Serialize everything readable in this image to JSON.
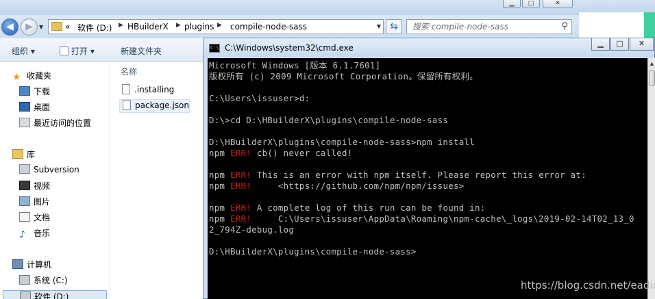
{
  "explorer": {
    "address": {
      "overflow": "«",
      "crumbs": [
        "软件 (D:)",
        "HBuilderX",
        "plugins",
        "compile-node-sass"
      ]
    },
    "search": {
      "placeholder": "搜索 compile-node-sass"
    },
    "toolbar": {
      "organize": "组织 ▾",
      "open": "打开 ▾",
      "new_folder": "新建文件夹"
    },
    "sidebar": {
      "favorites": "收藏夹",
      "downloads": "下载",
      "desktop": "桌面",
      "recent": "最近访问的位置",
      "libraries": "库",
      "subversion": "Subversion",
      "videos": "视频",
      "pictures": "图片",
      "documents": "文档",
      "music": "音乐",
      "computer": "计算机",
      "system_drive": "系统 (C:)",
      "software_drive": "软件 (D:)"
    },
    "files": {
      "column_name": "名称",
      "items": [
        ".installing",
        "package.json"
      ]
    }
  },
  "cmd": {
    "title": "C:\\Windows\\system32\\cmd.exe",
    "controls": {
      "minimize": "▁",
      "maximize": "□",
      "close": "✕"
    },
    "lines": {
      "l1": "Microsoft Windows [版本 6.1.7601]",
      "l2": "版权所有 (c) 2009 Microsoft Corporation。保留所有权利。",
      "l4": "C:\\Users\\issuser>d:",
      "l6": "D:\\>cd D:\\HBuilderX\\plugins\\compile-node-sass",
      "l8": "D:\\HBuilderX\\plugins\\compile-node-sass>npm install",
      "npm": "npm",
      "err": "ERR!",
      "e1": " cb() never called!",
      "e2": " This is an error with npm itself. Please report this error at:",
      "e3": "     <https://github.com/npm/npm/issues>",
      "e4": " A complete log of this run can be found in:",
      "e5": "     C:\\Users\\issuser\\AppData\\Roaming\\npm-cache\\_logs\\2019-02-14T02_13_0",
      "e5b": "2_794Z-debug.log",
      "l_last": "D:\\HBuilderX\\plugins\\compile-node-sass>"
    }
  },
  "watermark": "https://blog.csdn.net/eadio",
  "colors": {
    "err": "#c31e1e",
    "console_bg": "#000000",
    "console_fg": "#c0c0c0"
  }
}
